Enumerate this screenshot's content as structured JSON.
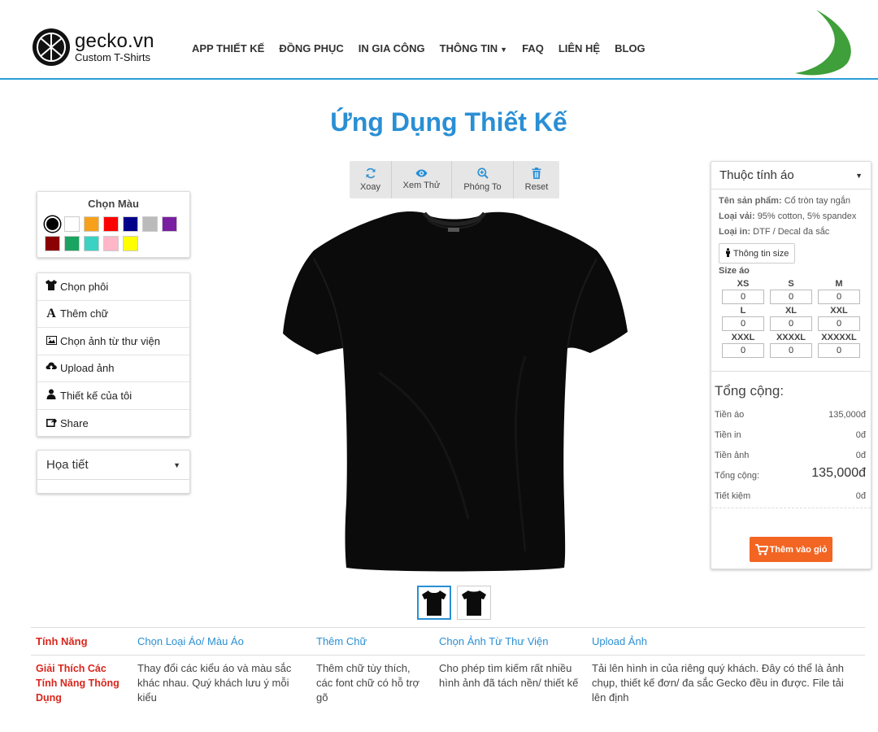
{
  "brand": {
    "name": "gecko.vn",
    "tagline": "Custom T-Shirts"
  },
  "nav": {
    "items": [
      {
        "label": "APP THIẾT KẾ"
      },
      {
        "label": "ĐỒNG PHỤC"
      },
      {
        "label": "IN GIA CÔNG"
      },
      {
        "label": "THÔNG TIN"
      },
      {
        "label": "FAQ"
      },
      {
        "label": "LIÊN HỆ"
      },
      {
        "label": "BLOG"
      }
    ]
  },
  "page": {
    "title": "Ứng Dụng Thiết Kế"
  },
  "color_panel": {
    "title": "Chọn Màu",
    "swatches": [
      "#000000",
      "#ffffff",
      "#f7a11a",
      "#ff0000",
      "#00008b",
      "#bbbbbb",
      "#7a1fa2",
      "#8b0000",
      "#1aa361",
      "#3cd2c3",
      "#ffb6c8",
      "#ffff00"
    ],
    "selected": "#000000"
  },
  "tools_menu": {
    "items": [
      {
        "label": "Chọn phôi",
        "icon": "tshirt-icon"
      },
      {
        "label": "Thêm chữ",
        "icon": "text-icon"
      },
      {
        "label": "Chọn ảnh từ thư viện",
        "icon": "image-icon"
      },
      {
        "label": "Upload ảnh",
        "icon": "upload-icon"
      },
      {
        "label": "Thiết kế của tôi",
        "icon": "user-icon"
      },
      {
        "label": "Share",
        "icon": "share-icon"
      }
    ]
  },
  "pattern_panel": {
    "title": "Họa tiết"
  },
  "toolbar": {
    "rotate": "Xoay",
    "preview": "Xem Thử",
    "zoom": "Phóng To",
    "reset": "Reset"
  },
  "attributes": {
    "title": "Thuộc tính áo",
    "product_label": "Tên sản phẩm:",
    "product_value": "Cổ tròn tay ngắn",
    "fabric_label": "Loại vải:",
    "fabric_value": "95% cotton, 5% spandex",
    "print_label": "Loại in:",
    "print_value": "DTF / Decal đa sắc",
    "size_info_button": "Thông tin size",
    "size_title": "Size áo",
    "sizes": [
      {
        "label": "XS",
        "qty": "0"
      },
      {
        "label": "S",
        "qty": "0"
      },
      {
        "label": "M",
        "qty": "0"
      },
      {
        "label": "L",
        "qty": "0"
      },
      {
        "label": "XL",
        "qty": "0"
      },
      {
        "label": "XXL",
        "qty": "0"
      },
      {
        "label": "XXXL",
        "qty": "0"
      },
      {
        "label": "XXXXL",
        "qty": "0"
      },
      {
        "label": "XXXXXL",
        "qty": "0"
      }
    ]
  },
  "totals": {
    "title": "Tổng cộng:",
    "shirt_label": "Tiền áo",
    "shirt_value": "135,000đ",
    "print_label": "Tiền in",
    "print_value": "0đ",
    "image_label": "Tiền ảnh",
    "image_value": "0đ",
    "total_label": "Tổng cộng:",
    "total_value": "135,000đ",
    "saving_label": "Tiết kiệm",
    "saving_value": "0đ",
    "cart_button": "Thêm vào giỏ"
  },
  "features": {
    "headers": [
      "Tính Năng",
      "Chọn Loại Áo/ Màu Áo",
      "Thêm Chữ",
      "Chọn Ảnh Từ Thư Viện",
      "Upload Ảnh"
    ],
    "row_label": "Giải Thích Các Tính Năng Thông Dụng",
    "row_values": [
      "Thay đổi các kiểu áo và màu sắc khác nhau. Quý khách lưu ý mỗi kiểu",
      "Thêm chữ tùy thích, các font chữ có hỗ trợ gõ",
      "Cho phép tìm kiếm rất nhiều hình ảnh đã tách nền/ thiết kế",
      "Tải lên hình in của riêng quý khách. Đây có thể là ảnh chụp, thiết kế đơn/ đa sắc Gecko đều in được. File tải lên định"
    ]
  },
  "colors": {
    "accent": "#2a8fd4",
    "cart": "#f26522",
    "feature_label": "#d9261c"
  }
}
